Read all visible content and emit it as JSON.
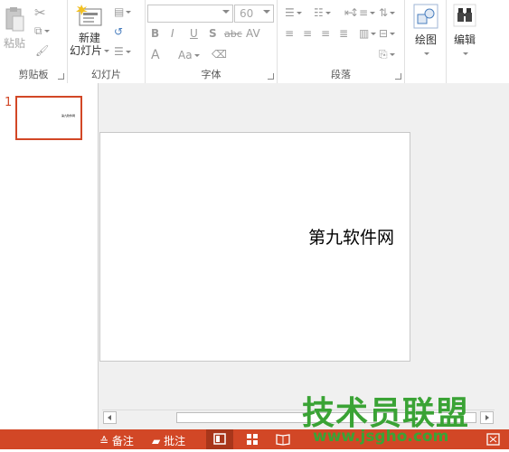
{
  "ribbon": {
    "clipboard": {
      "paste_label": "粘贴",
      "group_label": "剪贴板"
    },
    "slides": {
      "new_slide_line1": "新建",
      "new_slide_line2": "幻灯片",
      "group_label": "幻灯片"
    },
    "font": {
      "font_size": "60",
      "group_label": "字体",
      "bold": "B",
      "italic": "I",
      "underline": "U",
      "shadow": "S",
      "strike": "abc",
      "spacing": "AV",
      "font_color": "A",
      "change_case": "Aa"
    },
    "paragraph": {
      "group_label": "段落"
    },
    "drawing": {
      "label": "绘图"
    },
    "editing": {
      "label": "编辑"
    }
  },
  "thumbnails": [
    {
      "number": "1",
      "preview_text": "第九软件网"
    }
  ],
  "slide": {
    "text": "第九软件网"
  },
  "status_bar": {
    "notes_label": "备注",
    "comments_label": "批注"
  },
  "watermark": {
    "main": "技术员联盟",
    "url": "www.jsgho.com"
  },
  "colors": {
    "accent": "#d24726",
    "thumb_selected": "#d24726",
    "watermark": "#3aa335"
  }
}
